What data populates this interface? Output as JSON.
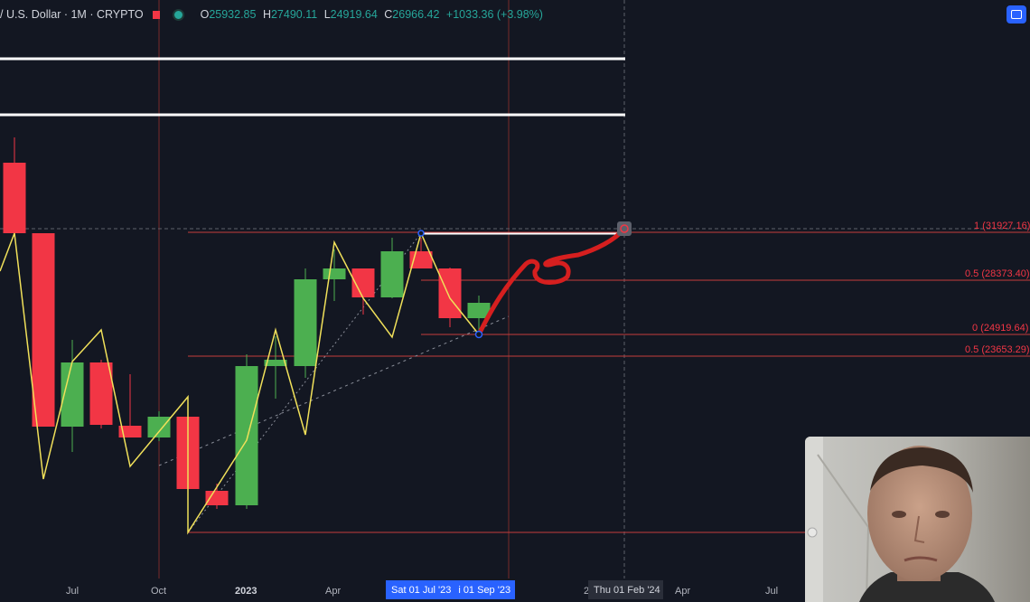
{
  "legend": {
    "symbol": "/ U.S. Dollar · 1M · CRYPTO",
    "open_key": "O",
    "open": "25932.85",
    "high_key": "H",
    "high": "27490.11",
    "low_key": "L",
    "low": "24919.64",
    "close_key": "C",
    "close": "26966.42",
    "change": "+1033.36 (+3.98%)"
  },
  "colors": {
    "up": "#4caf50",
    "down": "#f23645",
    "background": "#131722",
    "zigzag": "#f0e05a",
    "accent": "#2962ff"
  },
  "fib_levels": [
    {
      "label": "1 (31927.16)"
    },
    {
      "label": "0.5 (28373.40)"
    },
    {
      "label": "0 (24919.64)"
    },
    {
      "label": "0.5 (23653.29)"
    }
  ],
  "x_axis": {
    "labels": [
      "Jul",
      "Oct",
      "2023",
      "Apr",
      "Jul",
      "Apr",
      "Jul"
    ],
    "cursor_label": "Sat 01 Jul '23",
    "cursor_label_2": "i 01 Sep '23",
    "cursor_label_3": "Thu 01 Feb '24",
    "partial": "2"
  },
  "webcam": {
    "icon": "webcam-overlay"
  }
}
